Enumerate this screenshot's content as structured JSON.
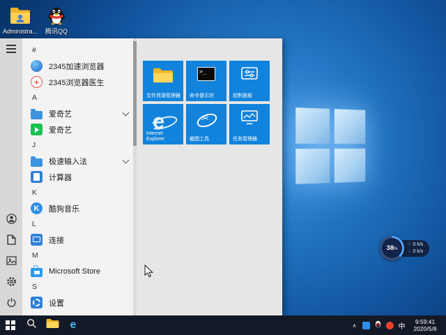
{
  "desktop": {
    "icons": [
      {
        "label": "Administra...",
        "icon": "user-folder-icon"
      },
      {
        "label": "腾讯QQ",
        "icon": "qq-penguin-icon"
      }
    ]
  },
  "start_menu": {
    "rail_icons": [
      "hamburger-menu-icon",
      "user-avatar-icon",
      "documents-icon",
      "pictures-icon",
      "settings-gear-icon",
      "power-icon"
    ],
    "app_list": [
      {
        "type": "header",
        "label": "#"
      },
      {
        "type": "app",
        "label": "2345加速浏览器",
        "icon": "2345-browser-icon"
      },
      {
        "type": "app",
        "label": "2345浏览器医生",
        "icon": "browser-doctor-icon"
      },
      {
        "type": "header",
        "label": "A"
      },
      {
        "type": "folder",
        "label": "爱奇艺",
        "icon": "app-folder-icon",
        "chevron": true
      },
      {
        "type": "app",
        "label": "爱奇艺",
        "icon": "iqiyi-icon"
      },
      {
        "type": "header",
        "label": "J"
      },
      {
        "type": "folder",
        "label": "极速输入法",
        "icon": "app-folder-icon",
        "chevron": true
      },
      {
        "type": "app",
        "label": "计算器",
        "icon": "calculator-icon"
      },
      {
        "type": "header",
        "label": "K"
      },
      {
        "type": "app",
        "label": "酷狗音乐",
        "icon": "kugou-music-icon"
      },
      {
        "type": "header",
        "label": "L"
      },
      {
        "type": "app",
        "label": "连接",
        "icon": "connect-icon"
      },
      {
        "type": "header",
        "label": "M"
      },
      {
        "type": "app",
        "label": "Microsoft Store",
        "icon": "microsoft-store-icon"
      },
      {
        "type": "header",
        "label": "S"
      },
      {
        "type": "app",
        "label": "设置",
        "icon": "settings-gear-icon"
      }
    ],
    "tiles": [
      {
        "label": "文件资源管理器",
        "icon": "file-explorer-folder-icon"
      },
      {
        "label": "命令提示符",
        "icon": "command-prompt-icon"
      },
      {
        "label": "控制面板",
        "icon": "control-panel-icon"
      },
      {
        "label": "Internet Explorer",
        "icon": "internet-explorer-icon"
      },
      {
        "label": "截图工具",
        "icon": "snipping-tool-icon"
      },
      {
        "label": "任务管理器",
        "icon": "task-manager-icon"
      }
    ]
  },
  "speed_widget": {
    "percent": "38",
    "unit": "%",
    "upload": "0 k/s",
    "download": "0 k/s"
  },
  "taskbar": {
    "ime": "中",
    "clock": {
      "time": "9:59:41",
      "date": "2020/5/8"
    }
  },
  "colors": {
    "accent_blue": "#1283dc",
    "taskbar_bg": "#141927",
    "desktop_blue": "#2173c0",
    "tile_blue": "#1283dc"
  }
}
